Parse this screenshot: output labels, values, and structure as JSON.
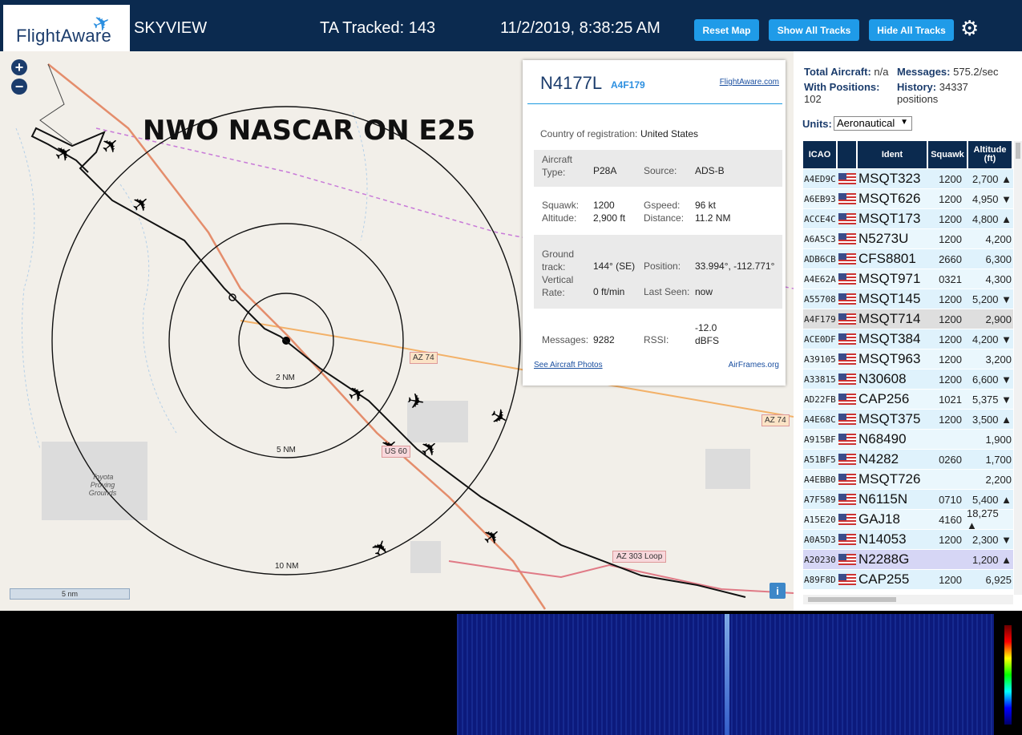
{
  "header": {
    "logo": "FlightAware",
    "app_name": "SKYVIEW",
    "tracked": "TA Tracked: 143",
    "datetime": "11/2/2019, 8:38:25 AM",
    "reset_map": "Reset Map",
    "show_all": "Show All Tracks",
    "hide_all": "Hide All Tracks"
  },
  "map": {
    "overlay_title": "NWO NASCAR ON E25",
    "ring_labels": [
      "2 NM",
      "5 NM",
      "10 NM"
    ],
    "road_labels": [
      "AZ 74",
      "AZ 74",
      "AZ 303 Loop",
      "US 60"
    ],
    "place_label": "Toyota Proving Grounds",
    "scale_label": "5 nm",
    "info": "i"
  },
  "popup": {
    "registration": "N4177L",
    "hex": "A4F179",
    "fa_link": "FlightAware.com",
    "country_label": "Country of registration:",
    "country_value": "United States",
    "type_label": "Aircraft Type:",
    "type_value": "P28A",
    "source_label": "Source:",
    "source_value": "ADS-B",
    "squawk_label": "Squawk:",
    "squawk_value": "1200",
    "gspeed_label": "Gspeed:",
    "gspeed_value": "96 kt",
    "altitude_label": "Altitude:",
    "altitude_value": "2,900 ft",
    "distance_label": "Distance:",
    "distance_value": "11.2 NM",
    "track_label": "Ground track:",
    "track_value": "144° (SE)",
    "position_label": "Position:",
    "position_value": "33.994°, -112.771°",
    "vrate_label": "Vertical Rate:",
    "vrate_value": "0 ft/min",
    "lastseen_label": "Last Seen:",
    "lastseen_value": "now",
    "messages_label": "Messages:",
    "messages_value": "9282",
    "rssi_label": "RSSI:",
    "rssi_value": "-12.0 dBFS",
    "photos_link": "See Aircraft Photos",
    "airframes_link": "AirFrames.org"
  },
  "sidebar": {
    "total_label": "Total Aircraft:",
    "total_value": "n/a",
    "messages_label": "Messages:",
    "messages_value": "575.2/sec",
    "positions_label": "With Positions:",
    "positions_value": "102",
    "history_label": "History:",
    "history_value": "34337 positions",
    "units_label": "Units:",
    "units_value": "Aeronautical",
    "columns": [
      "ICAO",
      "Ident",
      "Squawk",
      "Altitude (ft)"
    ],
    "rows": [
      {
        "icao": "A4ED9C",
        "ident": "MSQT323",
        "squawk": "1200",
        "alt": "2,700 ▲"
      },
      {
        "icao": "A6EB93",
        "ident": "MSQT626",
        "squawk": "1200",
        "alt": "4,950 ▼"
      },
      {
        "icao": "ACCE4C",
        "ident": "MSQT173",
        "squawk": "1200",
        "alt": "4,800 ▲"
      },
      {
        "icao": "A6A5C3",
        "ident": "N5273U",
        "squawk": "1200",
        "alt": "4,200"
      },
      {
        "icao": "ADB6CB",
        "ident": "CFS8801",
        "squawk": "2660",
        "alt": "6,300"
      },
      {
        "icao": "A4E62A",
        "ident": "MSQT971",
        "squawk": "0321",
        "alt": "4,300"
      },
      {
        "icao": "A55708",
        "ident": "MSQT145",
        "squawk": "1200",
        "alt": "5,200 ▼"
      },
      {
        "icao": "A4F179",
        "ident": "MSQT714",
        "squawk": "1200",
        "alt": "2,900"
      },
      {
        "icao": "ACE0DF",
        "ident": "MSQT384",
        "squawk": "1200",
        "alt": "4,200 ▼"
      },
      {
        "icao": "A39105",
        "ident": "MSQT963",
        "squawk": "1200",
        "alt": "3,200"
      },
      {
        "icao": "A33815",
        "ident": "N30608",
        "squawk": "1200",
        "alt": "6,600 ▼"
      },
      {
        "icao": "AD22FB",
        "ident": "CAP256",
        "squawk": "1021",
        "alt": "5,375 ▼"
      },
      {
        "icao": "A4E68C",
        "ident": "MSQT375",
        "squawk": "1200",
        "alt": "3,500 ▲"
      },
      {
        "icao": "A915BF",
        "ident": "N68490",
        "squawk": "",
        "alt": "1,900"
      },
      {
        "icao": "A51BF5",
        "ident": "N4282",
        "squawk": "0260",
        "alt": "1,700"
      },
      {
        "icao": "A4EBB0",
        "ident": "MSQT726",
        "squawk": "",
        "alt": "2,200"
      },
      {
        "icao": "A7F589",
        "ident": "N6115N",
        "squawk": "0710",
        "alt": "5,400 ▲"
      },
      {
        "icao": "A15E20",
        "ident": "GAJ18",
        "squawk": "4160",
        "alt": "18,275 ▲"
      },
      {
        "icao": "A0A5D3",
        "ident": "N14053",
        "squawk": "1200",
        "alt": "2,300 ▼"
      },
      {
        "icao": "A20230",
        "ident": "N2288G",
        "squawk": "",
        "alt": "1,200 ▲"
      },
      {
        "icao": "A89F8D",
        "ident": "CAP255",
        "squawk": "1200",
        "alt": "6,925"
      }
    ]
  }
}
